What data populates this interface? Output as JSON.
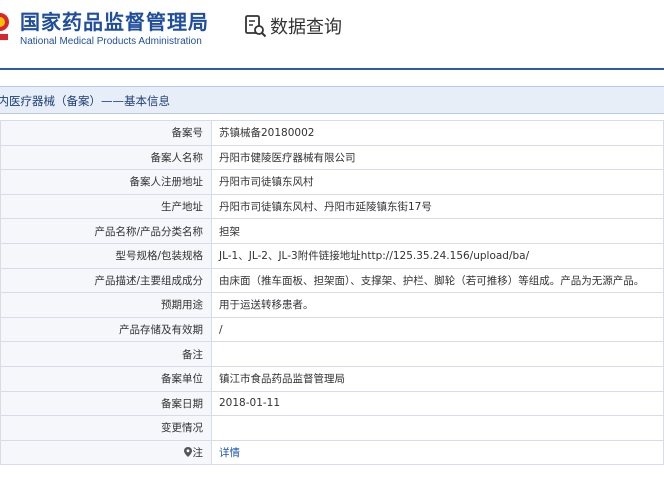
{
  "header": {
    "org_name_cn": "国家药品监督管理局",
    "org_name_en": "National Medical Products Administration",
    "page_title": "数据查询",
    "accent_color": "#1f4e9e"
  },
  "section": {
    "title": "境内医疗器械（备案）——基本信息"
  },
  "rows": [
    {
      "label": "备案号",
      "value": "苏镇械备20180002"
    },
    {
      "label": "备案人名称",
      "value": "丹阳市健陵医疗器械有限公司"
    },
    {
      "label": "备案人注册地址",
      "value": "丹阳市司徒镇东风村"
    },
    {
      "label": "生产地址",
      "value": "丹阳市司徒镇东风村、丹阳市延陵镇东街17号"
    },
    {
      "label": "产品名称/产品分类名称",
      "value": "担架"
    },
    {
      "label": "型号规格/包装规格",
      "value": "JL-1、JL-2、JL-3附件链接地址http://125.35.24.156/upload/ba/"
    },
    {
      "label": "产品描述/主要组成成分",
      "value": "由床面（推车面板、担架面）、支撑架、护栏、脚轮（若可推移）等组成。产品为无源产品。"
    },
    {
      "label": "预期用途",
      "value": "用于运送转移患者。"
    },
    {
      "label": "产品存储及有效期",
      "value": "/"
    },
    {
      "label": "备注",
      "value": ""
    },
    {
      "label": "备案单位",
      "value": "镇江市食品药品监督管理局"
    },
    {
      "label": "备案日期",
      "value": "2018-01-11"
    },
    {
      "label": "变更情况",
      "value": ""
    }
  ],
  "note_row": {
    "label": "注",
    "link_text": "详情"
  }
}
